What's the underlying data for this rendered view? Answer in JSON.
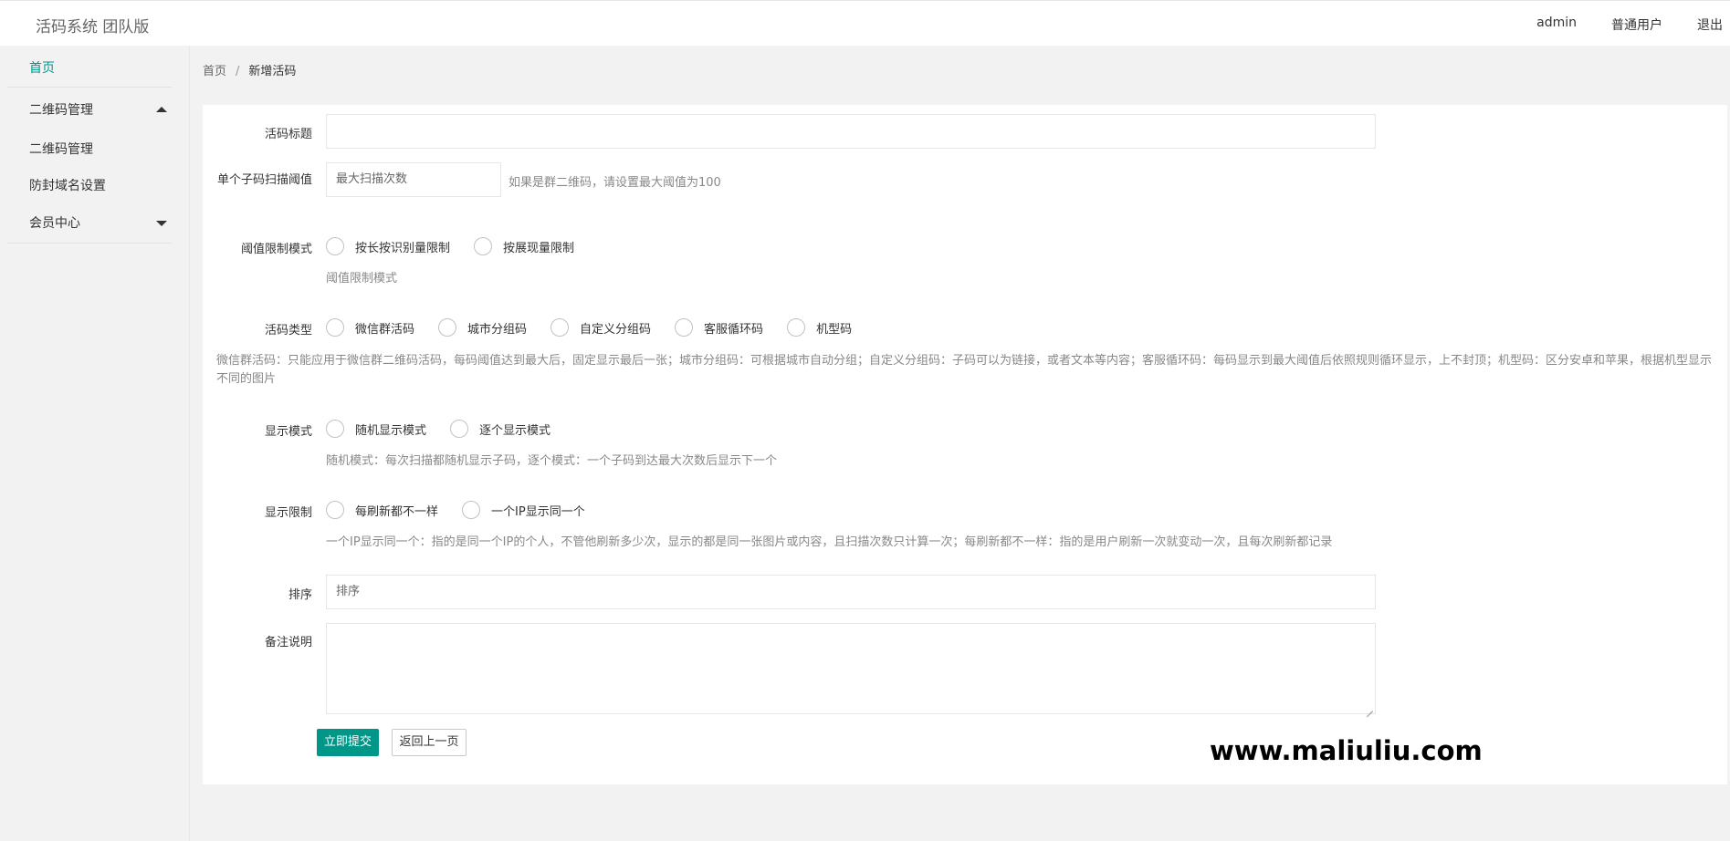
{
  "app": {
    "title": "活码系统 团队版"
  },
  "topnav": {
    "user": "admin",
    "role": "普通用户",
    "logout": "退出"
  },
  "sidebar": {
    "home": "首页",
    "qr_group": "二维码管理",
    "qr_manage": "二维码管理",
    "domain_settings": "防封域名设置",
    "member_center": "会员中心"
  },
  "breadcrumb": {
    "home": "首页",
    "separator": "/",
    "current": "新增活码"
  },
  "form": {
    "title_label": "活码标题",
    "title_value": "",
    "threshold_label": "单个子码扫描阈值",
    "threshold_placeholder": "最大扫描次数",
    "threshold_hint": "如果是群二维码，请设置最大阈值为100",
    "limit_mode_label": "阈值限制模式",
    "limit_mode_options": [
      "按长按识别量限制",
      "按展现量限制"
    ],
    "limit_mode_desc": "阈值限制模式",
    "type_label": "活码类型",
    "type_options": [
      "微信群活码",
      "城市分组码",
      "自定义分组码",
      "客服循环码",
      "机型码"
    ],
    "type_desc": "微信群活码：只能应用于微信群二维码活码，每码阈值达到最大后，固定显示最后一张；城市分组码：可根据城市自动分组；自定义分组码：子码可以为链接，或者文本等内容；客服循环码：每码显示到最大阈值后依照规则循环显示，上不封顶；机型码：区分安卓和苹果，根据机型显示不同的图片",
    "display_mode_label": "显示模式",
    "display_mode_options": [
      "随机显示模式",
      "逐个显示模式"
    ],
    "display_mode_desc": "随机模式：每次扫描都随机显示子码，逐个模式：一个子码到达最大次数后显示下一个",
    "display_limit_label": "显示限制",
    "display_limit_options": [
      "每刷新都不一样",
      "一个IP显示同一个"
    ],
    "display_limit_desc": "一个IP显示同一个：指的是同一个IP的个人，不管他刷新多少次，显示的都是同一张图片或内容，且扫描次数只计算一次；每刷新都不一样：指的是用户刷新一次就变动一次，且每次刷新都记录",
    "sort_label": "排序",
    "sort_placeholder": "排序",
    "remark_label": "备注说明",
    "submit": "立即提交",
    "back": "返回上一页"
  },
  "watermark": "www.maliuliu.com"
}
